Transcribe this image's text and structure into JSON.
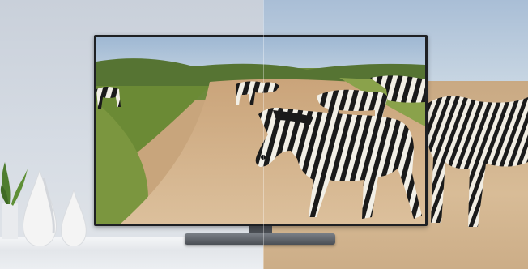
{
  "scene": {
    "description_label": "",
    "colors": {
      "wall": "#cfd5dd",
      "sky": "#b8cbe0",
      "dirt_road": "#d3b48d",
      "grass": "#6b8a35",
      "tv_frame": "#1e2023",
      "shelf": "#eef0f3",
      "vase": "#f3f3f3",
      "zebra_black": "#1a1a1a",
      "zebra_white": "#f2efe6"
    }
  }
}
